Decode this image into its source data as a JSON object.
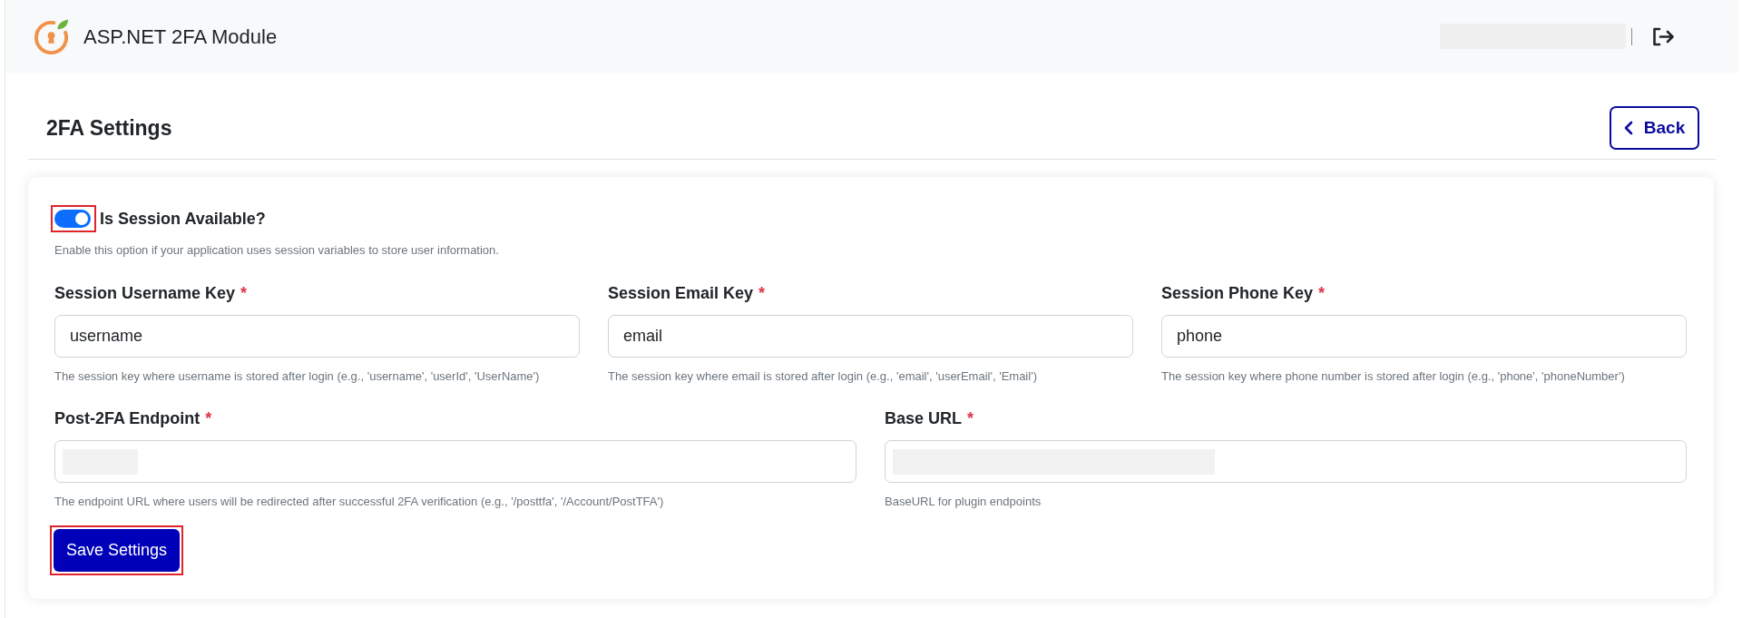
{
  "header": {
    "title": "ASP.NET 2FA Module",
    "user_redacted": true
  },
  "page": {
    "title": "2FA Settings",
    "back_button": {
      "label": "Back"
    }
  },
  "session_toggle": {
    "label": "Is Session Available?",
    "on": true,
    "highlighted": true,
    "help": "Enable this option if your application uses session variables to store user information."
  },
  "field_rows": [
    {
      "fields": [
        {
          "label": "Session Username Key",
          "required_mark": "*",
          "value": "username",
          "redacted": false,
          "help": "The session key where username is stored after login (e.g., 'username', 'userId', 'UserName')"
        },
        {
          "label": "Session Email Key",
          "required_mark": "*",
          "value": "email",
          "redacted": false,
          "help": "The session key where email is stored after login (e.g., 'email', 'userEmail', 'Email')"
        },
        {
          "label": "Session Phone Key",
          "required_mark": "*",
          "value": "phone",
          "redacted": false,
          "help": "The session key where phone number is stored after login (e.g., 'phone', 'phoneNumber')"
        }
      ]
    },
    {
      "fields": [
        {
          "label": "Post-2FA Endpoint",
          "required_mark": "*",
          "redacted": true,
          "help": "The endpoint URL where users will be redirected after successful 2FA verification (e.g., '/posttfa', '/Account/PostTFA')"
        },
        {
          "label": "Base URL",
          "required_mark": "*",
          "redacted": true,
          "help": "BaseURL for plugin endpoints"
        }
      ]
    }
  ],
  "save_button": {
    "label": "Save Settings",
    "highlighted": true
  }
}
